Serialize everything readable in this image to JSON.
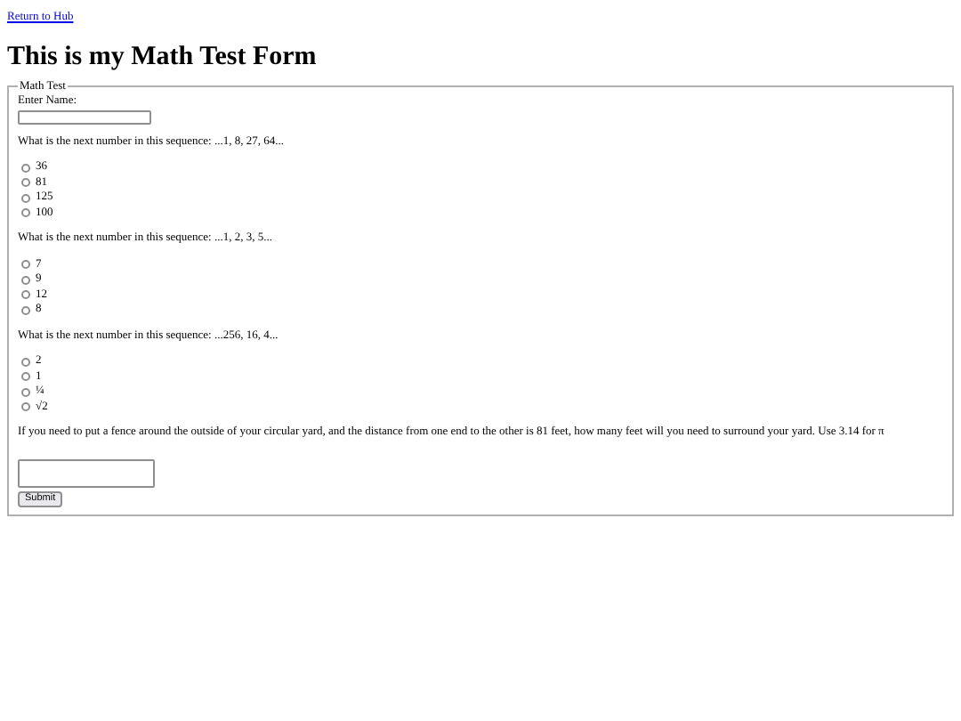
{
  "link": "Return to Hub",
  "heading": "This is my Math Test Form",
  "form": {
    "legend": "Math Test",
    "name_label": "Enter Name:",
    "questions": [
      {
        "kind": "radio",
        "text": "What is the next number in this sequence: ...1, 8, 27, 64...",
        "options": [
          {
            "label": "36",
            "selected": false
          },
          {
            "label": "81",
            "selected": false
          },
          {
            "label": "125",
            "selected": false
          },
          {
            "label": "100",
            "selected": false
          }
        ]
      },
      {
        "kind": "radio",
        "text": "What is the next number in this sequence: ...1, 2, 3, 5...",
        "options": [
          {
            "label": "7",
            "selected": false
          },
          {
            "label": "9",
            "selected": false
          },
          {
            "label": "12",
            "selected": false
          },
          {
            "label": "8",
            "selected": false
          }
        ]
      },
      {
        "kind": "radio",
        "text": "What is the next number in this sequence: ...256, 16, 4...",
        "options": [
          {
            "label": "2",
            "selected": false
          },
          {
            "label": "1",
            "selected": false
          },
          {
            "label": "¼",
            "selected": false
          },
          {
            "label": "√2",
            "selected": false
          }
        ]
      },
      {
        "kind": "text",
        "text": "If you need to put a fence around the outside of your circular yard, and the distance from one end to the other is 81 feet, how many feet will you need to surround your yard. Use 3.14 for π"
      }
    ],
    "submit": "Submit"
  }
}
